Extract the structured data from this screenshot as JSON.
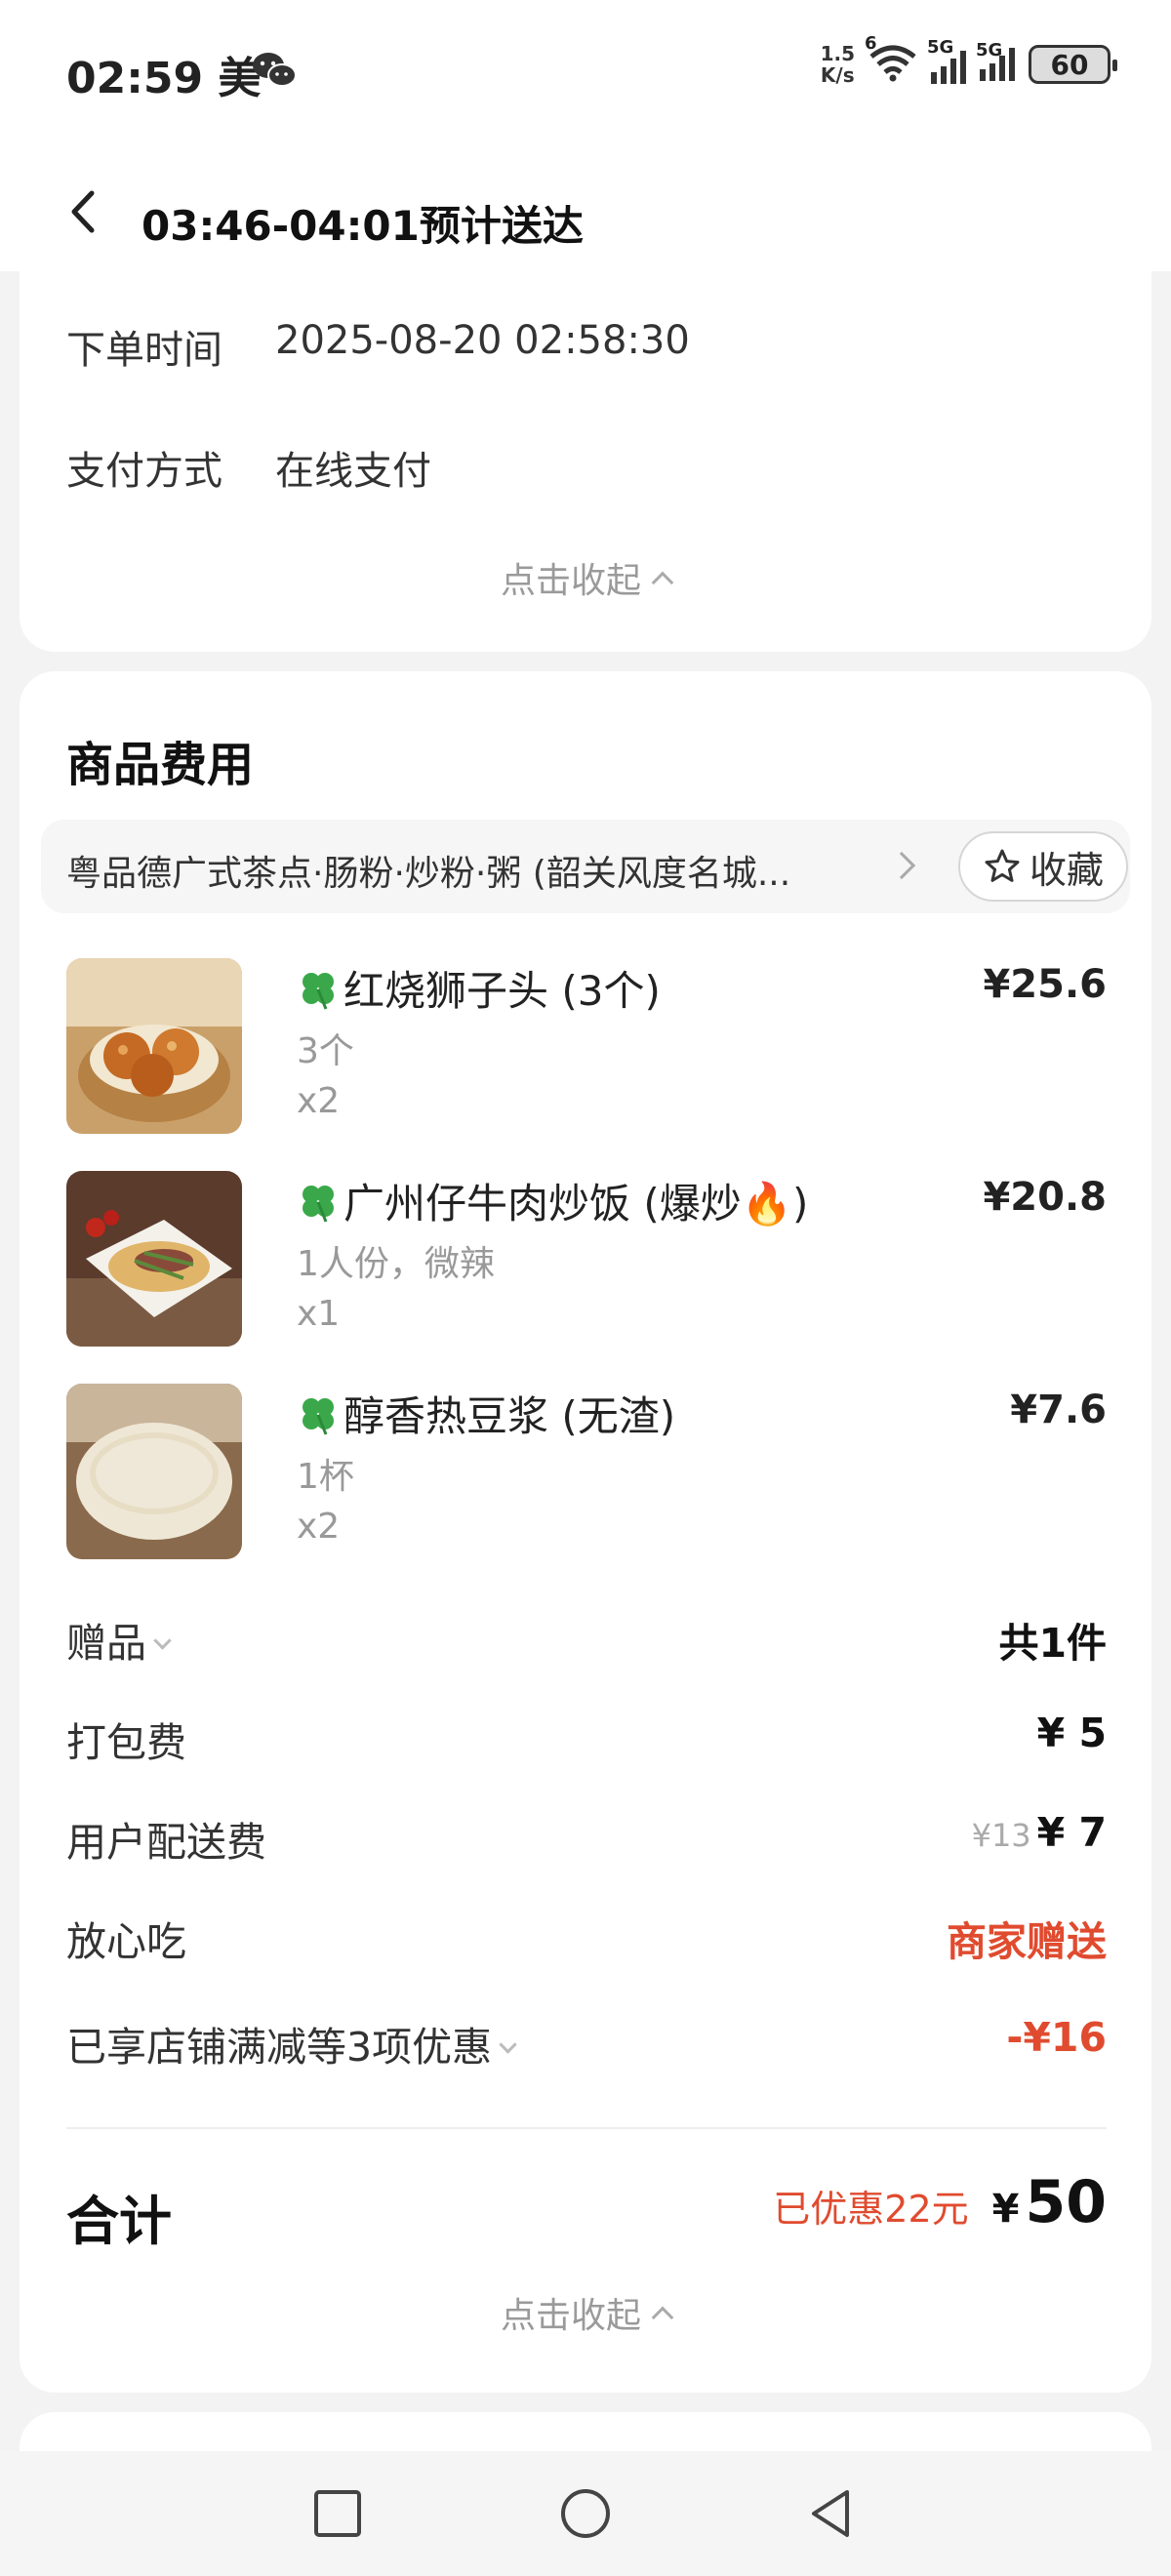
{
  "status_bar": {
    "time": "02:59 美",
    "net_speed_value": "1.5",
    "net_speed_unit": "K/s",
    "wifi_tag": "6",
    "sim1": "5G",
    "sim2": "5G",
    "battery": "60"
  },
  "header": {
    "title": "03:46-04:01预计送达"
  },
  "order_info": {
    "order_time_label": "下单时间",
    "order_time_value": "2025-08-20 02:58:30",
    "payment_label": "支付方式",
    "payment_value": "在线支付",
    "collapse_label": "点击收起"
  },
  "goods": {
    "title": "商品费用",
    "shop_name": "粤品德广式茶点·肠粉·炒粉·粥 (韶关风度名城...",
    "favorite_label": "收藏",
    "items": [
      {
        "name": "红烧狮子头 (3个)",
        "spec": "3个",
        "qty": "x2",
        "price": "¥25.6"
      },
      {
        "name": "广州仔牛肉炒饭 (爆炒🔥)",
        "spec": "1人份，微辣",
        "qty": "x1",
        "price": "¥20.8"
      },
      {
        "name": "醇香热豆浆 (无渣)",
        "spec": "1杯",
        "qty": "x2",
        "price": "¥7.6"
      }
    ]
  },
  "fees": {
    "gift_label": "赠品",
    "gift_value": "共1件",
    "packing_label": "打包费",
    "packing_value": "¥ 5",
    "delivery_label": "用户配送费",
    "delivery_original": "¥13",
    "delivery_value": "¥ 7",
    "assurance_label": "放心吃",
    "assurance_value": "商家赠送",
    "discount_label": "已享店铺满减等3项优惠",
    "discount_value": "-¥16"
  },
  "total": {
    "label": "合计",
    "saved": "已优惠22元",
    "currency": "¥",
    "amount": "50",
    "collapse_label": "点击收起"
  },
  "colors": {
    "accent_red": "#e04b2f",
    "background": "#f3f3f3",
    "card": "#ffffff"
  }
}
